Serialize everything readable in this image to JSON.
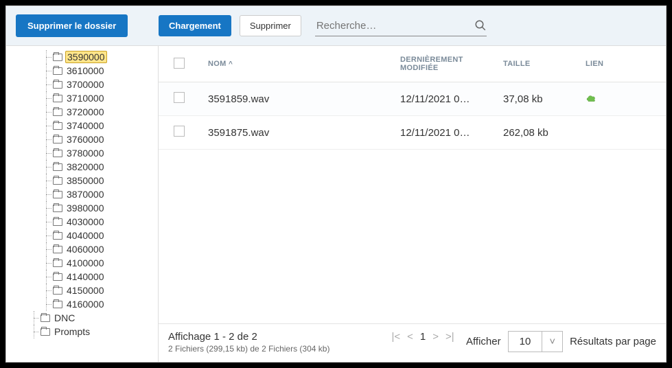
{
  "topbar": {
    "delete_folder_label": "Supprimer le dossier",
    "upload_label": "Chargement",
    "delete_label": "Supprimer",
    "search_placeholder": "Recherche…"
  },
  "tree": {
    "items": [
      {
        "label": "3590000",
        "selected": true,
        "level": 3
      },
      {
        "label": "3610000",
        "level": 3
      },
      {
        "label": "3700000",
        "level": 3
      },
      {
        "label": "3710000",
        "level": 3
      },
      {
        "label": "3720000",
        "level": 3
      },
      {
        "label": "3740000",
        "level": 3
      },
      {
        "label": "3760000",
        "level": 3
      },
      {
        "label": "3780000",
        "level": 3
      },
      {
        "label": "3820000",
        "level": 3
      },
      {
        "label": "3850000",
        "level": 3
      },
      {
        "label": "3870000",
        "level": 3
      },
      {
        "label": "3980000",
        "level": 3
      },
      {
        "label": "4030000",
        "level": 3
      },
      {
        "label": "4040000",
        "level": 3
      },
      {
        "label": "4060000",
        "level": 3
      },
      {
        "label": "4100000",
        "level": 3
      },
      {
        "label": "4140000",
        "level": 3
      },
      {
        "label": "4150000",
        "level": 3
      },
      {
        "label": "4160000",
        "level": 3
      },
      {
        "label": "DNC",
        "level": 2
      },
      {
        "label": "Prompts",
        "level": 2
      }
    ]
  },
  "table": {
    "headers": {
      "nom": "NOM",
      "sort_indicator": "^",
      "modified": "DERNIÈREMENT MODIFIÉE",
      "size": "TAILLE",
      "link": "LIEN"
    },
    "rows": [
      {
        "nom": "3591859.wav",
        "modified": "12/11/2021 0…",
        "size": "37,08 kb",
        "has_link": true
      },
      {
        "nom": "3591875.wav",
        "modified": "12/11/2021 0…",
        "size": "262,08 kb",
        "has_link": false
      }
    ]
  },
  "footer": {
    "display_text": "Affichage 1 - 2 de 2",
    "sub_text": "2 Fichiers (299,15 kb) de 2 Fichiers (304 kb)",
    "page_num": "1",
    "show_label": "Afficher",
    "per_page_value": "10",
    "per_page_label": "Résultats par page"
  }
}
